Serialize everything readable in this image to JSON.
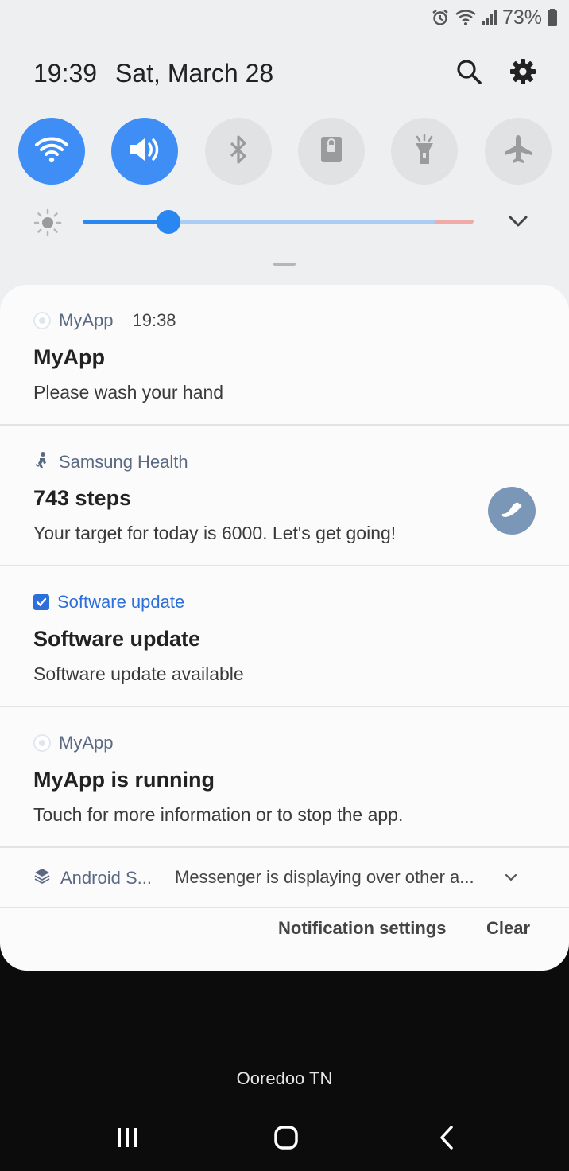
{
  "status_bar": {
    "battery_percent": "73%",
    "icons": [
      "alarm-icon",
      "wifi-call-icon",
      "signal-icon",
      "battery-icon"
    ]
  },
  "header": {
    "time": "19:39",
    "date": "Sat, March 28",
    "icons": [
      "search-icon",
      "gear-icon"
    ]
  },
  "quick_toggles": [
    {
      "name": "wifi",
      "icon": "wifi-icon",
      "on": true
    },
    {
      "name": "sound",
      "icon": "speaker-icon",
      "on": true
    },
    {
      "name": "bluetooth",
      "icon": "bluetooth-icon",
      "on": false
    },
    {
      "name": "screen-rotation-lock",
      "icon": "lock-icon",
      "on": false
    },
    {
      "name": "flashlight",
      "icon": "flashlight-icon",
      "on": false
    },
    {
      "name": "airplane-mode",
      "icon": "airplane-icon",
      "on": false
    }
  ],
  "brightness": {
    "level": 0.22
  },
  "colors": {
    "accent": "#3e8ef5",
    "shade_bg": "#eeeff1",
    "panel_bg": "#fbfbfc",
    "app_name": "#5b6a83"
  },
  "notifications": [
    {
      "app": "MyApp",
      "time": "19:38",
      "title": "MyApp",
      "text": "Please wash your hand",
      "icon": "app-circle-icon"
    },
    {
      "app": "Samsung Health",
      "title": "743 steps",
      "text": "Your target for today is 6000. Let's get going!",
      "icon": "samsung-health-icon",
      "action_icon": "shoe-icon"
    },
    {
      "app": "Software update",
      "title": "Software update",
      "text": "Software update available",
      "icon": "checkbox-icon"
    },
    {
      "app": "MyApp",
      "title": "MyApp is running",
      "text": "Touch for more information or to stop the app.",
      "icon": "app-circle-icon"
    }
  ],
  "grouped_notification": {
    "app": "Android S...",
    "text": "Messenger is displaying over other a...",
    "icon": "android-system-icon"
  },
  "panel_actions": {
    "settings_label": "Notification settings",
    "clear_label": "Clear"
  },
  "carrier": "Ooredoo TN",
  "nav_bar": [
    "recents-icon",
    "home-icon",
    "back-icon"
  ]
}
